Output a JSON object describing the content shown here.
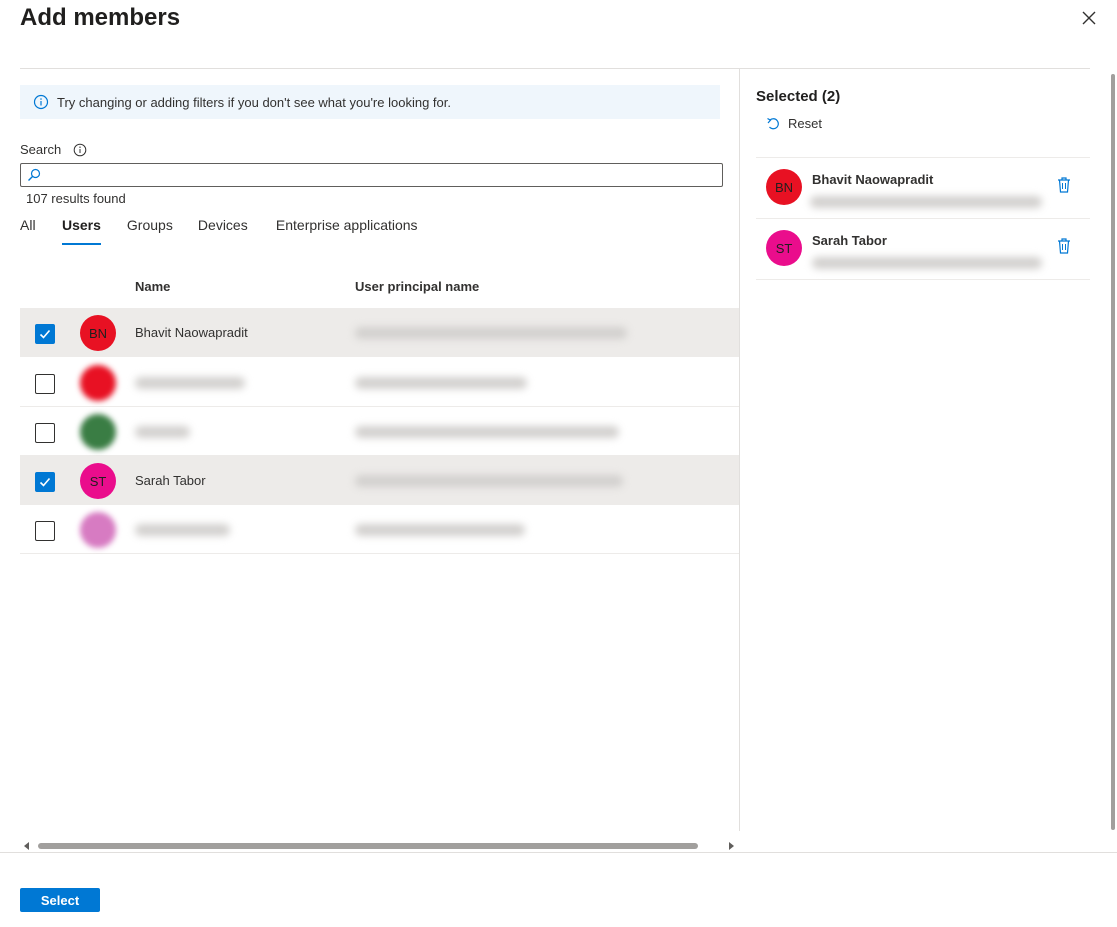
{
  "dialog": {
    "title": "Add members"
  },
  "info": {
    "message": "Try changing or adding filters if you don't see what you're looking for."
  },
  "search": {
    "label": "Search",
    "value": "",
    "results": "107 results found"
  },
  "tabs": [
    {
      "label": "All",
      "active": false
    },
    {
      "label": "Users",
      "active": true
    },
    {
      "label": "Groups",
      "active": false
    },
    {
      "label": "Devices",
      "active": false
    },
    {
      "label": "Enterprise applications",
      "active": false
    }
  ],
  "table": {
    "headers": {
      "name": "Name",
      "upn": "User principal name"
    },
    "rows": [
      {
        "initials": "BN",
        "name": "Bhavit Naowapradit",
        "checked": true,
        "color": "#e81123"
      },
      {
        "initials": "",
        "name": "",
        "checked": false,
        "color": "#e81123"
      },
      {
        "initials": "",
        "name": "",
        "checked": false,
        "color": "#3a7d44"
      },
      {
        "initials": "ST",
        "name": "Sarah Tabor",
        "checked": true,
        "color": "#ea0d8c"
      },
      {
        "initials": "",
        "name": "",
        "checked": false,
        "color": "#d77bc2"
      }
    ]
  },
  "selected": {
    "title": "Selected (2)",
    "reset_label": "Reset",
    "items": [
      {
        "initials": "BN",
        "name": "Bhavit Naowapradit",
        "color": "#e81123"
      },
      {
        "initials": "ST",
        "name": "Sarah Tabor",
        "color": "#ea0d8c"
      }
    ]
  },
  "footer": {
    "select_label": "Select"
  },
  "colors": {
    "accent": "#0078d4",
    "info_bg": "#eff6fc"
  }
}
